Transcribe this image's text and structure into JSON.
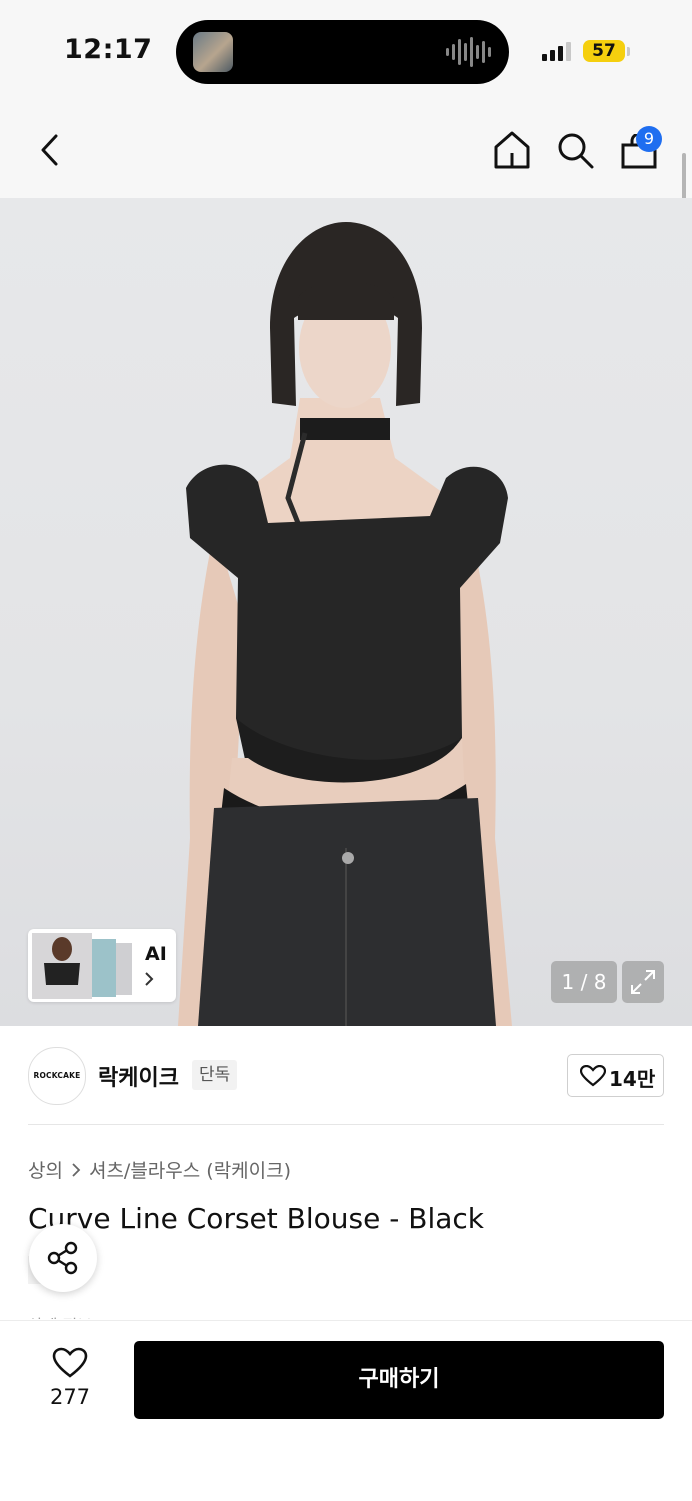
{
  "status_bar": {
    "time": "12:17",
    "battery": "57"
  },
  "header": {
    "cart_count": "9"
  },
  "gallery": {
    "counter": "1 / 8",
    "similar_label": "AI"
  },
  "brand": {
    "name": "락케이크",
    "logo_text": "ROCKCAKE",
    "exclusive_badge": "단독",
    "likes": "14만"
  },
  "product": {
    "breadcrumb": [
      "상의",
      "셔츠/블라우스 (락케이크)"
    ],
    "title": "Curve Line Corset Blouse - Black",
    "exclusive_badge": "단독",
    "cutoff_text": "상세 정보"
  },
  "bottom_bar": {
    "wish_count": "277",
    "buy_label": "구매하기"
  },
  "colors": {
    "accent_badge": "#1f6ef0",
    "battery": "#f5cf0e",
    "buy_button": "#000000"
  }
}
